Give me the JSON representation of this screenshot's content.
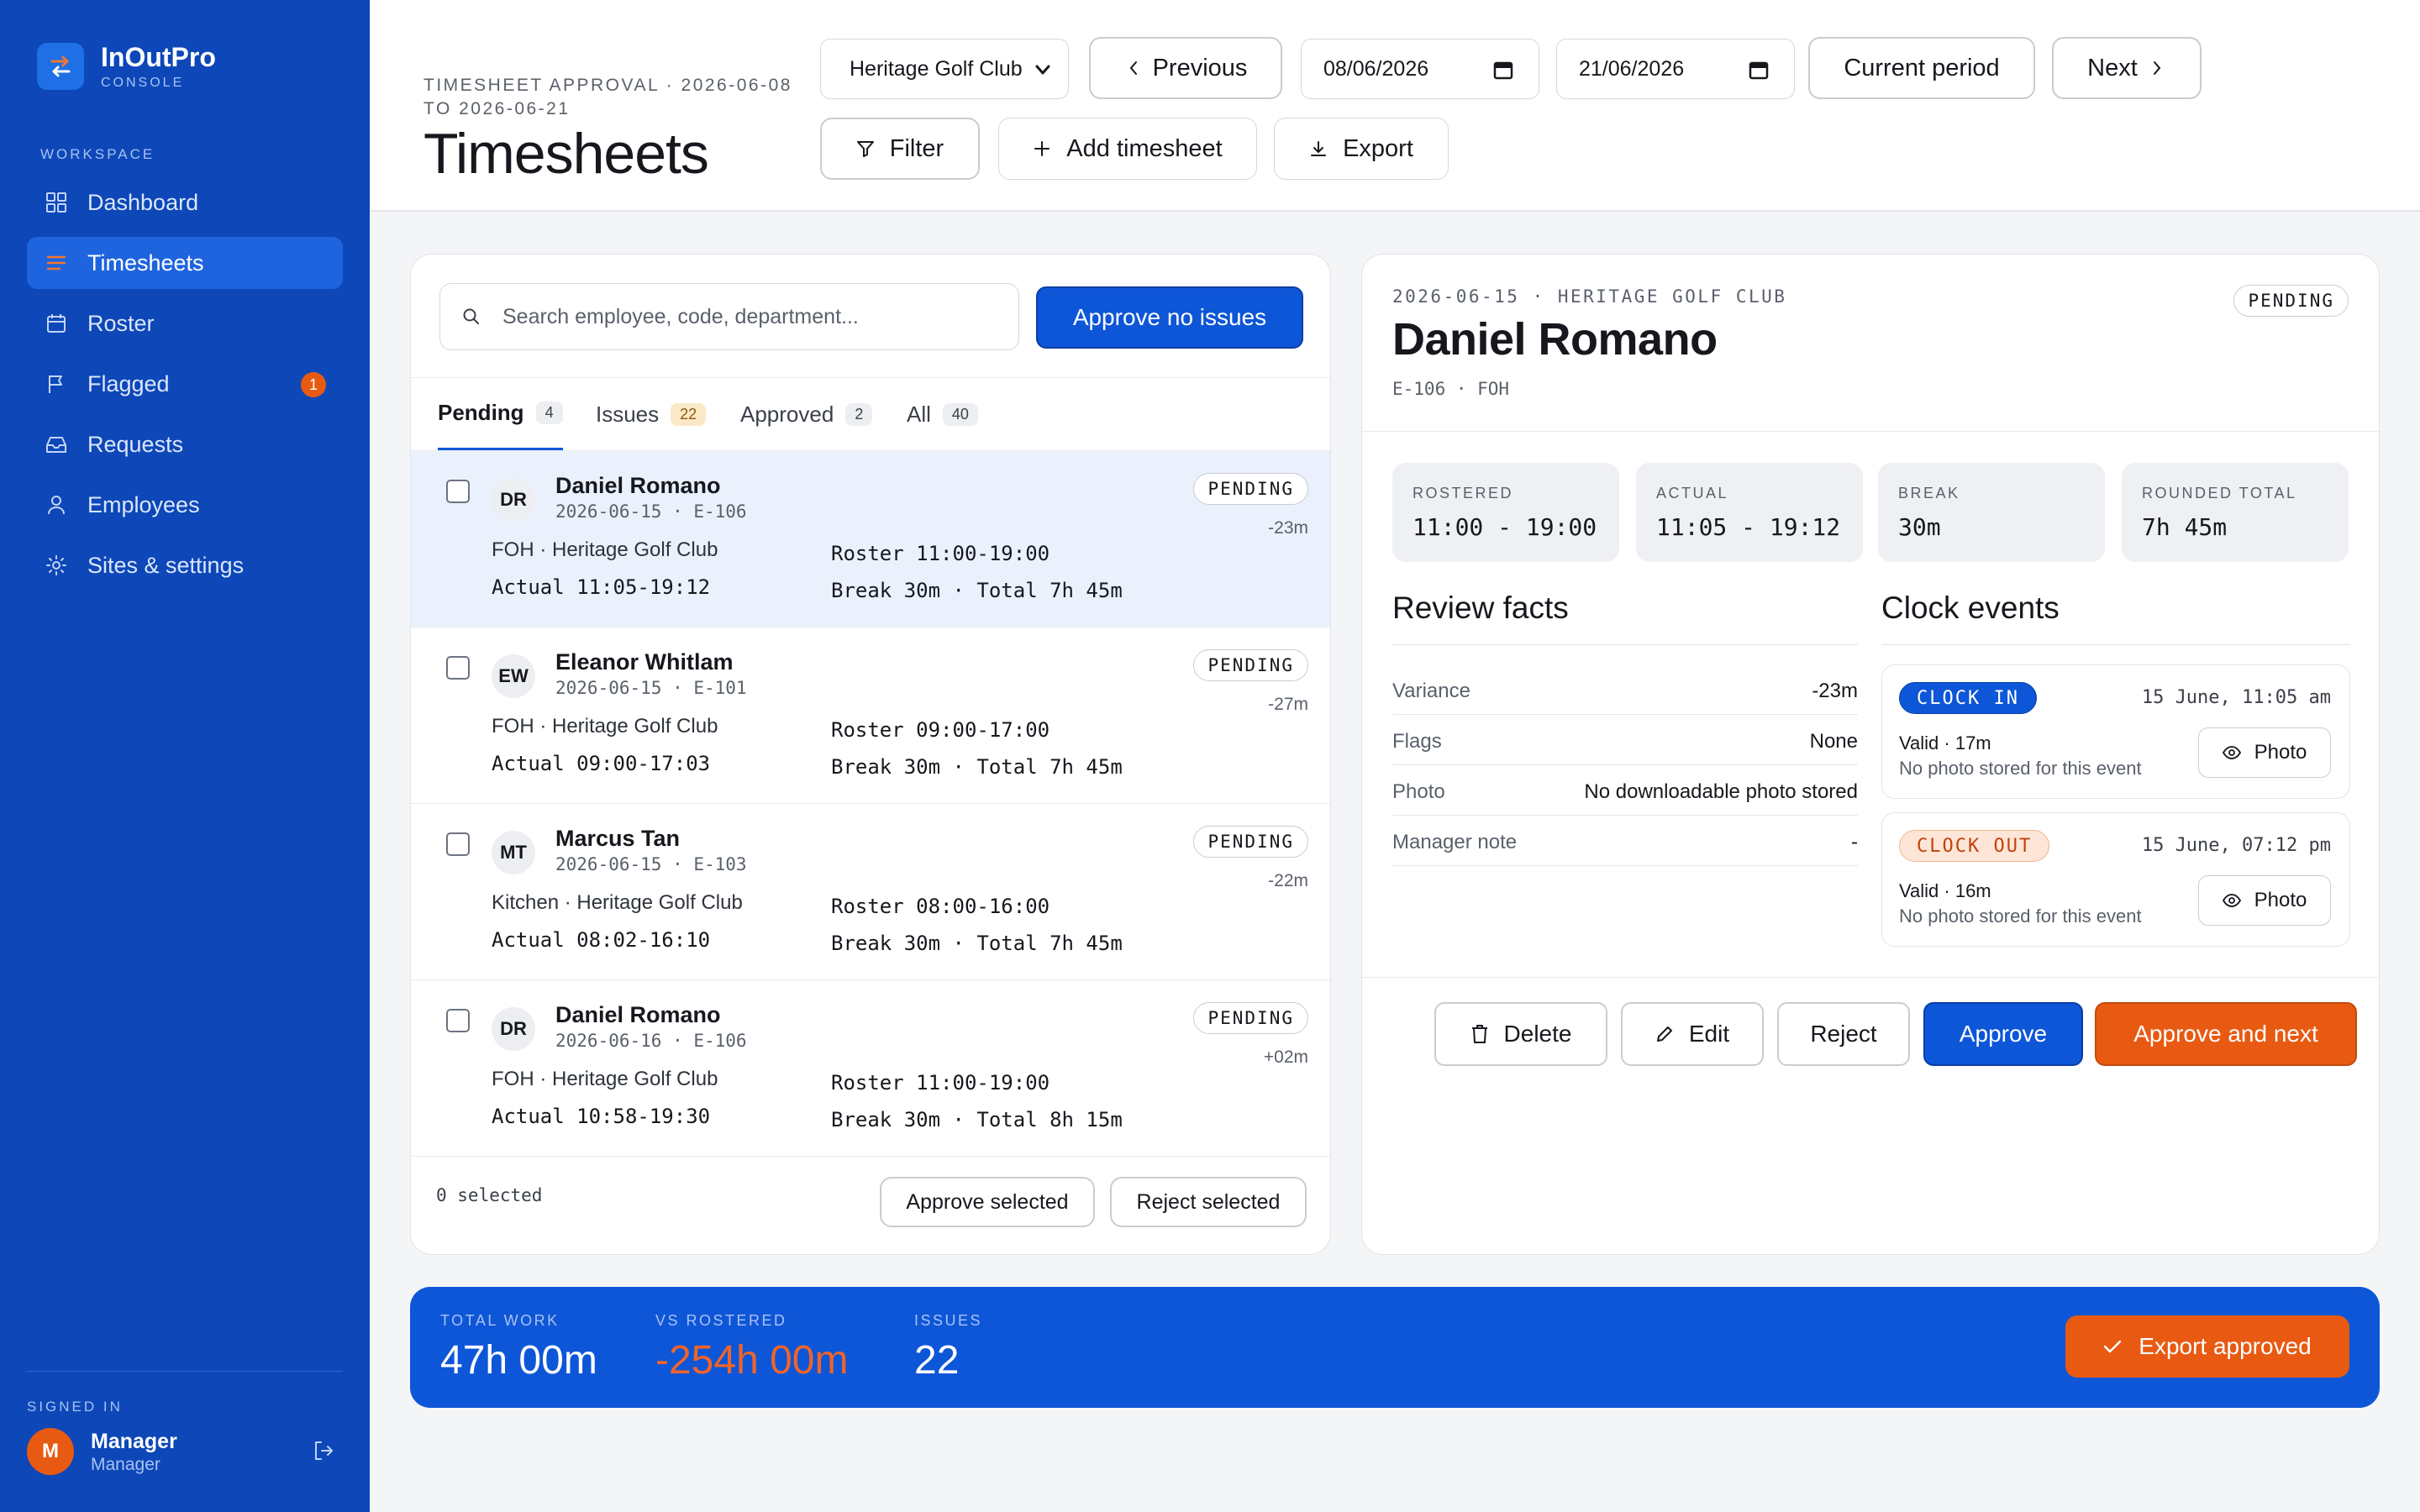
{
  "app": {
    "name": "InOutPro",
    "subtitle": "CONSOLE"
  },
  "sidebar": {
    "section_label": "WORKSPACE",
    "items": [
      {
        "label": "Dashboard",
        "icon": "grid-icon",
        "active": false
      },
      {
        "label": "Timesheets",
        "icon": "list-icon",
        "active": true
      },
      {
        "label": "Roster",
        "icon": "calendar-icon",
        "active": false
      },
      {
        "label": "Flagged",
        "icon": "flag-icon",
        "active": false,
        "badge": "1"
      },
      {
        "label": "Requests",
        "icon": "inbox-icon",
        "active": false
      },
      {
        "label": "Employees",
        "icon": "user-icon",
        "active": false
      },
      {
        "label": "Sites & settings",
        "icon": "gear-icon",
        "active": false
      }
    ],
    "signed_in_label": "SIGNED IN",
    "user": {
      "initial": "M",
      "name": "Manager",
      "role": "Manager"
    }
  },
  "header": {
    "breadcrumb": "TIMESHEET APPROVAL · 2026-06-08 TO 2026-06-21",
    "title": "Timesheets",
    "site_select": "Heritage Golf Club",
    "previous_label": "Previous",
    "date_from": "08/06/2026",
    "date_to": "21/06/2026",
    "current_period_label": "Current period",
    "next_label": "Next",
    "filter_label": "Filter",
    "add_label": "Add timesheet",
    "export_label": "Export"
  },
  "list": {
    "search_placeholder": "Search employee, code, department...",
    "approve_no_issues_label": "Approve no issues",
    "tabs": [
      {
        "label": "Pending",
        "count": "4"
      },
      {
        "label": "Issues",
        "count": "22"
      },
      {
        "label": "Approved",
        "count": "2"
      },
      {
        "label": "All",
        "count": "40"
      }
    ],
    "rows": [
      {
        "initials": "DR",
        "name": "Daniel Romano",
        "meta": "2026-06-15 · E-106",
        "status": "PENDING",
        "variance": "-23m",
        "dept": "FOH · Heritage Golf Club",
        "actual": "Actual 11:05-19:12",
        "roster": "Roster 11:00-19:00",
        "break_total": "Break 30m · Total 7h 45m"
      },
      {
        "initials": "EW",
        "name": "Eleanor Whitlam",
        "meta": "2026-06-15 · E-101",
        "status": "PENDING",
        "variance": "-27m",
        "dept": "FOH · Heritage Golf Club",
        "actual": "Actual 09:00-17:03",
        "roster": "Roster 09:00-17:00",
        "break_total": "Break 30m · Total 7h 45m"
      },
      {
        "initials": "MT",
        "name": "Marcus Tan",
        "meta": "2026-06-15 · E-103",
        "status": "PENDING",
        "variance": "-22m",
        "dept": "Kitchen · Heritage Golf Club",
        "actual": "Actual 08:02-16:10",
        "roster": "Roster 08:00-16:00",
        "break_total": "Break 30m · Total 7h 45m"
      },
      {
        "initials": "DR",
        "name": "Daniel Romano",
        "meta": "2026-06-16 · E-106",
        "status": "PENDING",
        "variance": "+02m",
        "dept": "FOH · Heritage Golf Club",
        "actual": "Actual 10:58-19:30",
        "roster": "Roster 11:00-19:00",
        "break_total": "Break 30m · Total 8h 15m"
      }
    ],
    "selected_count": "0 selected",
    "approve_selected_label": "Approve selected",
    "reject_selected_label": "Reject selected"
  },
  "detail": {
    "breadcrumb": "2026-06-15 · HERITAGE GOLF CLUB",
    "name": "Daniel Romano",
    "code": "E-106 · FOH",
    "status": "PENDING",
    "stats": [
      {
        "label": "ROSTERED",
        "value": "11:00 - 19:00"
      },
      {
        "label": "ACTUAL",
        "value": "11:05 - 19:12"
      },
      {
        "label": "BREAK",
        "value": "30m"
      },
      {
        "label": "ROUNDED TOTAL",
        "value": "7h 45m"
      }
    ],
    "review_title": "Review facts",
    "facts": [
      {
        "label": "Variance",
        "value": "-23m"
      },
      {
        "label": "Flags",
        "value": "None"
      },
      {
        "label": "Photo",
        "value": "No downloadable photo stored"
      },
      {
        "label": "Manager note",
        "value": "-"
      }
    ],
    "clock_title": "Clock events",
    "events": [
      {
        "type": "CLOCK IN",
        "time": "15 June, 11:05 am",
        "valid": "Valid · 17m",
        "photo_note": "No photo stored for this event",
        "photo_label": "Photo"
      },
      {
        "type": "CLOCK OUT",
        "time": "15 June, 07:12 pm",
        "valid": "Valid · 16m",
        "photo_note": "No photo stored for this event",
        "photo_label": "Photo"
      }
    ],
    "actions": {
      "delete": "Delete",
      "edit": "Edit",
      "reject": "Reject",
      "approve": "Approve",
      "approve_next": "Approve and next"
    }
  },
  "totals": {
    "total_work_label": "TOTAL WORK",
    "total_work": "47h 00m",
    "vs_rostered_label": "VS ROSTERED",
    "vs_rostered": "-254h 00m",
    "issues_label": "ISSUES",
    "issues": "22",
    "export_approved_label": "Export approved"
  },
  "colors": {
    "sidebar": "#0d47b8",
    "primary": "#0d56d8",
    "accent": "#e85a12",
    "negative": "#f0642a"
  }
}
